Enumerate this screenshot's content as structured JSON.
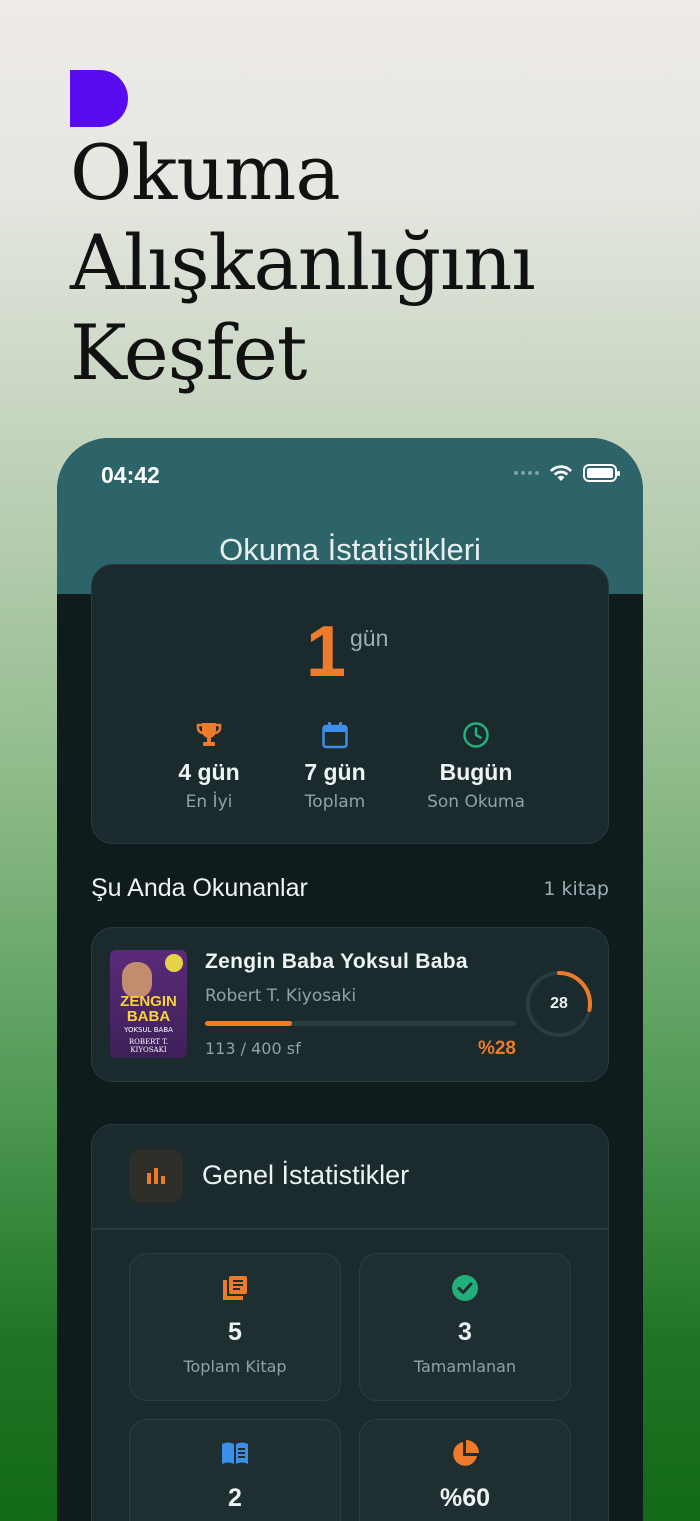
{
  "headline": {
    "line1": "Okuma",
    "line2": "Alışkanlığını",
    "line3": "Keşfet"
  },
  "status_bar": {
    "time": "04:42"
  },
  "header": {
    "title": "Okuma İstatistikleri"
  },
  "streak": {
    "value": "1",
    "unit": "gün",
    "stats": [
      {
        "value": "4 gün",
        "label": "En İyi",
        "icon": "trophy-icon",
        "color": "#ee7a2b"
      },
      {
        "value": "7 gün",
        "label": "Toplam",
        "icon": "calendar-icon",
        "color": "#3d8ee8"
      },
      {
        "value": "Bugün",
        "label": "Son Okuma",
        "icon": "clock-icon",
        "color": "#22b07a"
      }
    ]
  },
  "currently_reading": {
    "title": "Şu Anda Okunanlar",
    "count": "1 kitap",
    "book": {
      "title": "Zengin Baba Yoksul Baba",
      "author": "Robert T. Kiyosaki",
      "pages": "113 / 400 sf",
      "percent_label": "%28",
      "progress": 0.28,
      "ring_label": "28",
      "cover": {
        "title_line1": "ZENGIN",
        "title_line2": "BABA",
        "subtitle": "YOKSUL BABA",
        "author": "ROBERT T. KIYOSAKI"
      }
    }
  },
  "general": {
    "title": "Genel İstatistikler",
    "tiles": [
      {
        "value": "5",
        "label": "Toplam Kitap",
        "icon": "books-icon",
        "color": "#ee7a2b"
      },
      {
        "value": "3",
        "label": "Tamamlanan",
        "icon": "check-circle-icon",
        "color": "#22b07a"
      },
      {
        "value": "2",
        "label": "",
        "icon": "open-book-icon",
        "color": "#3d8ee8"
      },
      {
        "value": "%60",
        "label": "",
        "icon": "pie-chart-icon",
        "color": "#ee7a2b"
      }
    ]
  },
  "colors": {
    "accent": "#ee7a2b",
    "brand": "#5a0cf0",
    "header": "#2d6469"
  }
}
